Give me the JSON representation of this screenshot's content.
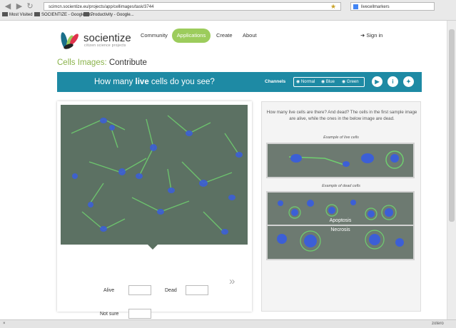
{
  "browser": {
    "url": "scimcn.socientize.eu/projects/app/cellimages/task/3744",
    "search_text": "livecellmarkers",
    "bookmarks": [
      "Most Visited",
      "SOCIENTIZE - Google Dr...",
      "Productivity - Google..."
    ],
    "status_left": "×",
    "status_right": "zotero"
  },
  "site": {
    "logo_text": "socientize",
    "logo_tagline": "citizen science projects",
    "nav": [
      "Community",
      "Applications",
      "Create",
      "About"
    ],
    "active_nav": "Applications",
    "signin": "Sign in"
  },
  "breadcrumb": {
    "project": "Cells Images",
    "separator": ": ",
    "page": "Contribute"
  },
  "banner": {
    "question_pre": "How many ",
    "question_bold": "live",
    "question_post": " cells do you see?",
    "channels_label": "Channels",
    "channels": [
      "Normal",
      "Blue",
      "Green"
    ]
  },
  "form": {
    "alive_label": "Alive",
    "dead_label": "Dead",
    "notsure_label": "Not sure",
    "alive_value": "",
    "dead_value": "",
    "notsure_value": ""
  },
  "help": {
    "description": "How many live cells are there? And dead? The cells in the first sample image are alive, while the ones in the below image are dead.",
    "live_caption": "Example of live cells",
    "dead_caption": "Example of dead cells",
    "apoptosis_label": "Apoptosis",
    "necrosis_label": "Necrosis"
  },
  "colors": {
    "accent_teal": "#1e8aa4",
    "accent_green": "#9ccc5c",
    "crumb_green": "#8ab34a"
  },
  "icons": {
    "back": "back-arrow-icon",
    "forward": "forward-arrow-icon",
    "reload": "reload-icon",
    "home": "home-icon",
    "video": "video-camera-icon",
    "info": "info-icon",
    "twitter": "twitter-bird-icon",
    "next": "chevron-right-icon"
  }
}
